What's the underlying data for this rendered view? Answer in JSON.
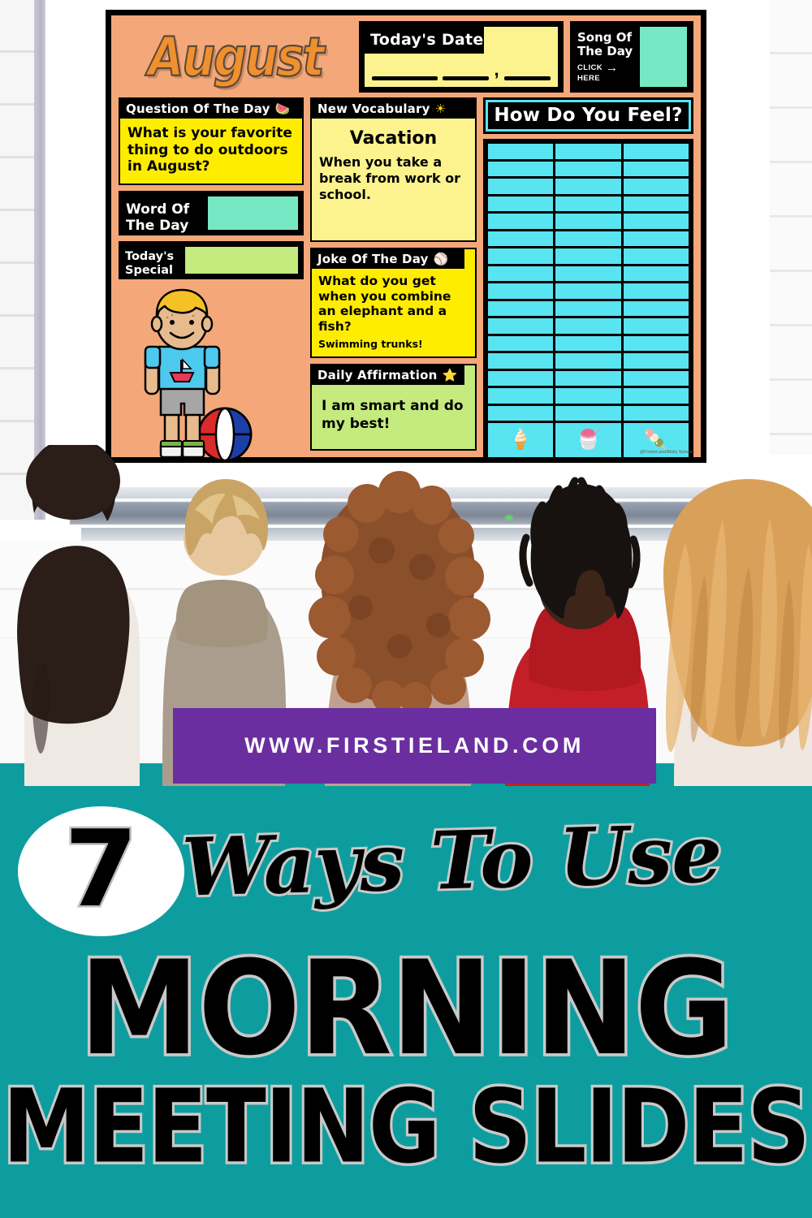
{
  "pin": {
    "url_bar": {
      "text": "WWW.FIRSTIELAND.COM",
      "bg": "#6a2ea0"
    },
    "headline": {
      "number": "7",
      "script_line": "Ways To Use",
      "big_line": "MORNING",
      "sub_line": "MEETING SLIDES"
    },
    "teal_bg": "#0d9d9f"
  },
  "slide": {
    "month_title": "August",
    "background": "#f4a87a",
    "todays_date": {
      "label": "Today's Date",
      "value": "",
      "separator": ","
    },
    "song_of_the_day": {
      "title": "Song Of The Day",
      "click": "CLICK",
      "here": "HERE",
      "arrow": "→",
      "swatch_color": "#76e8c4"
    },
    "question_of_the_day": {
      "header": "Question Of The Day",
      "icon": "watermelon-icon",
      "icon_glyph": "🍉",
      "text": "What is your favorite thing to do outdoors in August?",
      "bg": "#ffed00"
    },
    "word_of_the_day": {
      "label": "Word Of The Day",
      "value": "",
      "swatch_color": "#76e8c4"
    },
    "todays_special": {
      "label": "Today's Special",
      "value": "",
      "swatch_color": "#c5ea7e"
    },
    "new_vocabulary": {
      "header": "New Vocabulary",
      "icon": "sun-icon",
      "icon_glyph": "☀",
      "word": "Vacation",
      "definition": "When you take a break from work or school.",
      "bg": "#fcf38e"
    },
    "joke_of_the_day": {
      "header": "Joke Of The Day",
      "icon": "baseball-icon",
      "icon_glyph": "⚾",
      "question": "What do you get when you combine an elephant and a fish?",
      "answer": "Swimming trunks!",
      "bg": "#ffed00"
    },
    "daily_affirmation": {
      "header": "Daily Affirmation",
      "icon": "star-icon",
      "icon_glyph": "⭐",
      "text": "I am smart and do my best!",
      "bg": "#c5ea7e"
    },
    "how_do_you_feel": {
      "header": "How Do You Feel?",
      "columns": 3,
      "rows": 16,
      "cell_color": "#59e4f2",
      "footer_icons": [
        "popsicle-happy-icon",
        "popsicle-neutral-icon",
        "popsicle-sad-icon"
      ],
      "footer_glyphs": [
        "🍦",
        "🍧",
        "🍡"
      ]
    },
    "watermark": "@FirstieLand/Molly Schwab",
    "clipart": "boy-with-beach-ball"
  },
  "photo": {
    "description": "five children seated facing an interactive whiteboard",
    "kids": [
      {
        "name": "child-1",
        "hair": "#2b1d18",
        "shirt": "#efe9e4"
      },
      {
        "name": "child-2",
        "hair": "#c9a464",
        "shirt": "#ab9d8e"
      },
      {
        "name": "child-3",
        "hair": "#8a4f2b",
        "shirt": "#c2a08e"
      },
      {
        "name": "child-4",
        "hair": "#171210",
        "shirt": "#c41f28"
      },
      {
        "name": "child-5",
        "hair": "#d9a05a",
        "shirt": "#efe7e0"
      }
    ]
  }
}
